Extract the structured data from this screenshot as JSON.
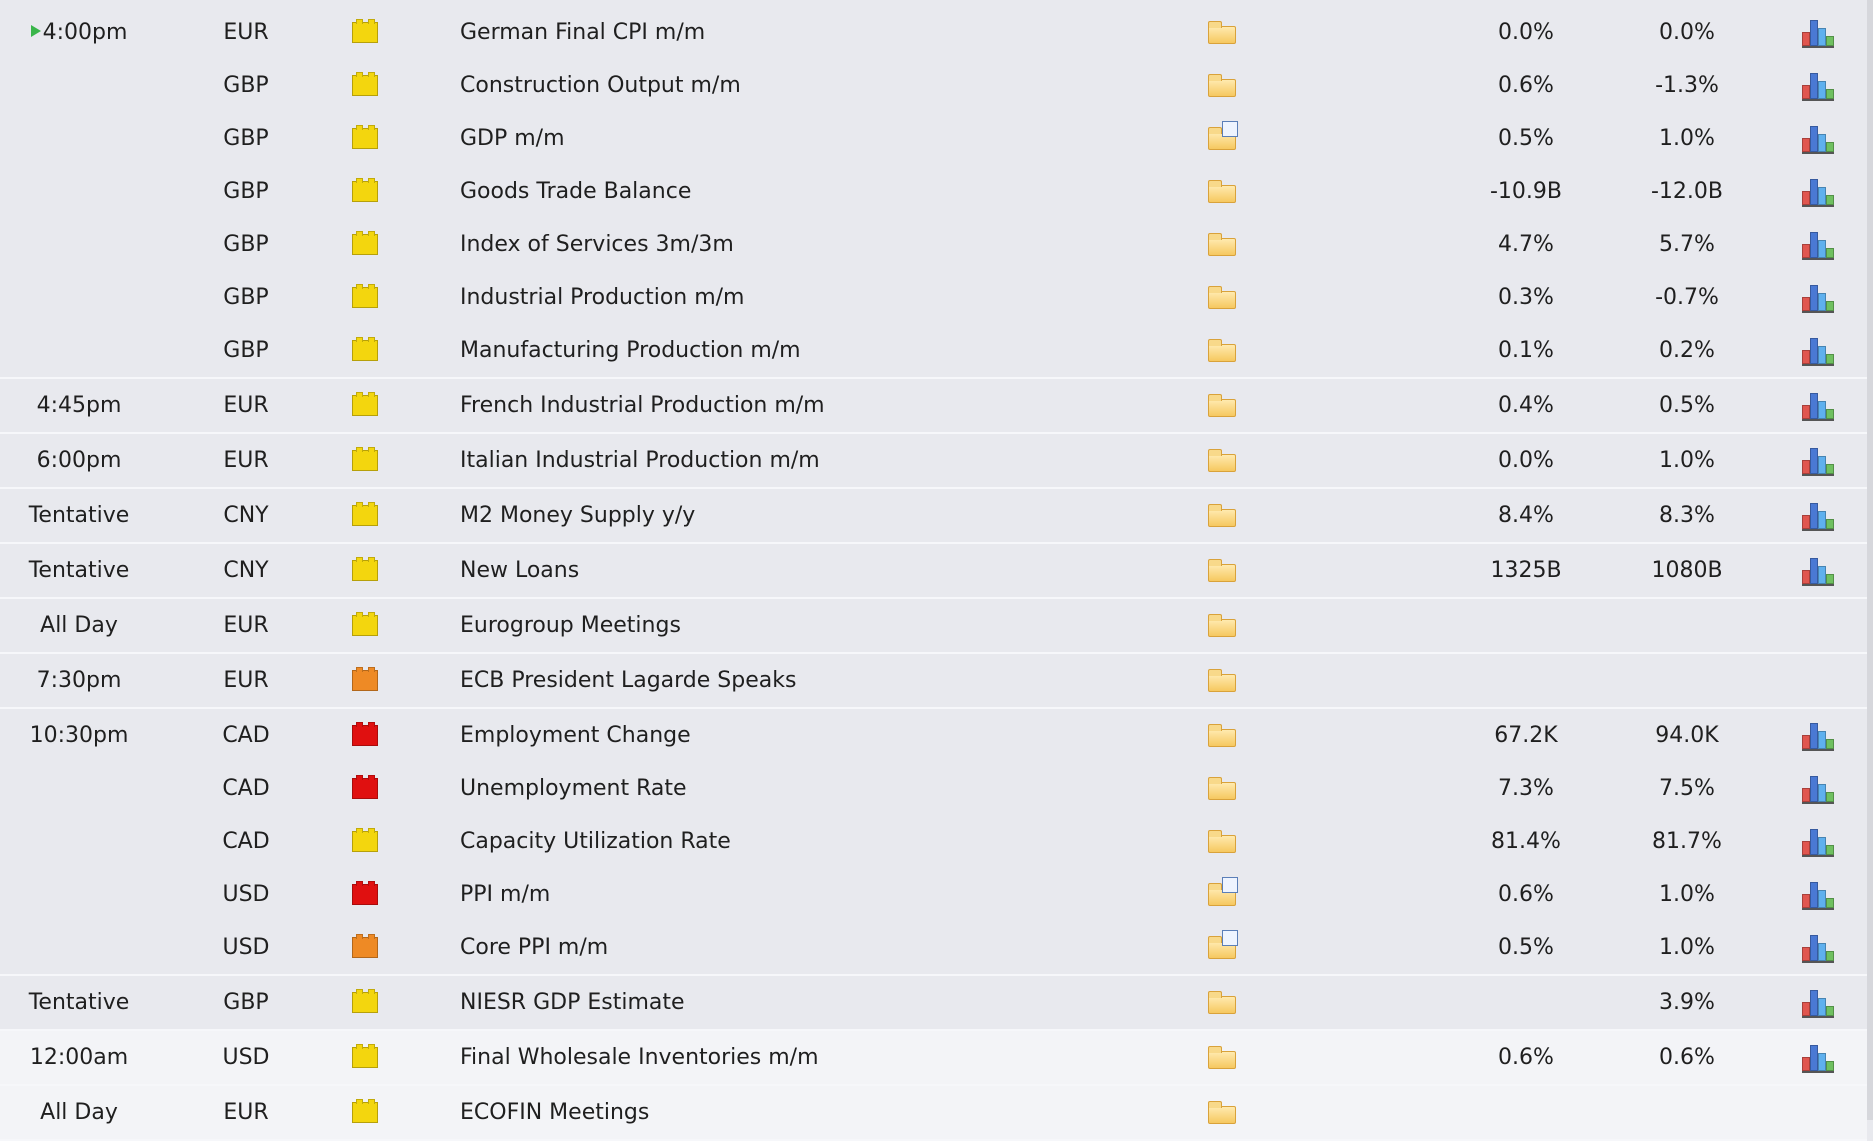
{
  "colors": {
    "impact_low": "#f3d60e",
    "impact_medium": "#ee8a25",
    "impact_high": "#e01010"
  },
  "groups": [
    {
      "time": "4:00pm",
      "active": true,
      "rows": [
        {
          "currency": "EUR",
          "impact": "low",
          "event": "German Final CPI m/m",
          "actual": "0.0%",
          "forecast": "0.0%",
          "doc": false,
          "graph": true
        },
        {
          "currency": "GBP",
          "impact": "low",
          "event": "Construction Output m/m",
          "actual": "0.6%",
          "forecast": "-1.3%",
          "doc": false,
          "graph": true
        },
        {
          "currency": "GBP",
          "impact": "low",
          "event": "GDP m/m",
          "actual": "0.5%",
          "forecast": "1.0%",
          "doc": true,
          "graph": true
        },
        {
          "currency": "GBP",
          "impact": "low",
          "event": "Goods Trade Balance",
          "actual": "-10.9B",
          "forecast": "-12.0B",
          "doc": false,
          "graph": true
        },
        {
          "currency": "GBP",
          "impact": "low",
          "event": "Index of Services 3m/3m",
          "actual": "4.7%",
          "forecast": "5.7%",
          "doc": false,
          "graph": true
        },
        {
          "currency": "GBP",
          "impact": "low",
          "event": "Industrial Production m/m",
          "actual": "0.3%",
          "forecast": "-0.7%",
          "doc": false,
          "graph": true
        },
        {
          "currency": "GBP",
          "impact": "low",
          "event": "Manufacturing Production m/m",
          "actual": "0.1%",
          "forecast": "0.2%",
          "doc": false,
          "graph": true
        }
      ]
    },
    {
      "time": "4:45pm",
      "rows": [
        {
          "currency": "EUR",
          "impact": "low",
          "event": "French Industrial Production m/m",
          "actual": "0.4%",
          "forecast": "0.5%",
          "doc": false,
          "graph": true
        }
      ]
    },
    {
      "time": "6:00pm",
      "rows": [
        {
          "currency": "EUR",
          "impact": "low",
          "event": "Italian Industrial Production m/m",
          "actual": "0.0%",
          "forecast": "1.0%",
          "doc": false,
          "graph": true
        }
      ]
    },
    {
      "time": "Tentative",
      "rows": [
        {
          "currency": "CNY",
          "impact": "low",
          "event": "M2 Money Supply y/y",
          "actual": "8.4%",
          "forecast": "8.3%",
          "doc": false,
          "graph": true
        }
      ]
    },
    {
      "time": "Tentative",
      "rows": [
        {
          "currency": "CNY",
          "impact": "low",
          "event": "New Loans",
          "actual": "1325B",
          "forecast": "1080B",
          "doc": false,
          "graph": true
        }
      ]
    },
    {
      "time": "All Day",
      "rows": [
        {
          "currency": "EUR",
          "impact": "low",
          "event": "Eurogroup Meetings",
          "actual": "",
          "forecast": "",
          "doc": false,
          "graph": false
        }
      ]
    },
    {
      "time": "7:30pm",
      "rows": [
        {
          "currency": "EUR",
          "impact": "medium",
          "event": "ECB President Lagarde Speaks",
          "actual": "",
          "forecast": "",
          "doc": false,
          "graph": false
        }
      ]
    },
    {
      "time": "10:30pm",
      "rows": [
        {
          "currency": "CAD",
          "impact": "high",
          "event": "Employment Change",
          "actual": "67.2K",
          "forecast": "94.0K",
          "doc": false,
          "graph": true
        },
        {
          "currency": "CAD",
          "impact": "high",
          "event": "Unemployment Rate",
          "actual": "7.3%",
          "forecast": "7.5%",
          "doc": false,
          "graph": true
        },
        {
          "currency": "CAD",
          "impact": "low",
          "event": "Capacity Utilization Rate",
          "actual": "81.4%",
          "forecast": "81.7%",
          "doc": false,
          "graph": true
        },
        {
          "currency": "USD",
          "impact": "high",
          "event": "PPI m/m",
          "actual": "0.6%",
          "forecast": "1.0%",
          "doc": true,
          "graph": true
        },
        {
          "currency": "USD",
          "impact": "medium",
          "event": "Core PPI m/m",
          "actual": "0.5%",
          "forecast": "1.0%",
          "doc": true,
          "graph": true
        }
      ]
    },
    {
      "time": "Tentative",
      "rows": [
        {
          "currency": "GBP",
          "impact": "low",
          "event": "NIESR GDP Estimate",
          "actual": "",
          "forecast": "3.9%",
          "doc": false,
          "graph": true
        }
      ]
    },
    {
      "time": "12:00am",
      "light": true,
      "rows": [
        {
          "currency": "USD",
          "impact": "low",
          "event": "Final Wholesale Inventories m/m",
          "actual": "0.6%",
          "forecast": "0.6%",
          "doc": false,
          "graph": true
        }
      ]
    },
    {
      "time": "All Day",
      "light": true,
      "rows": [
        {
          "currency": "EUR",
          "impact": "low",
          "event": "ECOFIN Meetings",
          "actual": "",
          "forecast": "",
          "doc": false,
          "graph": false
        }
      ]
    }
  ]
}
